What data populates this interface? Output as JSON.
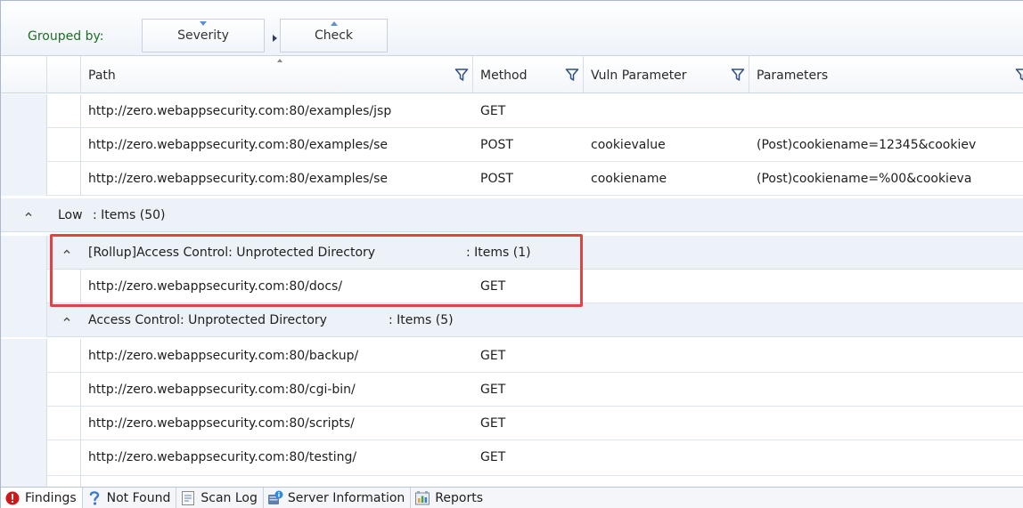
{
  "groupbar": {
    "label": "Grouped by:",
    "chips": [
      "Severity",
      "Check"
    ]
  },
  "columns": [
    "Path",
    "Method",
    "Vuln Parameter",
    "Parameters"
  ],
  "top_rows": [
    {
      "path": "http://zero.webappsecurity.com:80/examples/jsp",
      "method": "GET",
      "vuln_param": "",
      "params": ""
    },
    {
      "path": "http://zero.webappsecurity.com:80/examples/se",
      "method": "POST",
      "vuln_param": "cookievalue",
      "params": "(Post)cookiename=12345&cookiev"
    },
    {
      "path": "http://zero.webappsecurity.com:80/examples/se",
      "method": "POST",
      "vuln_param": "cookiename",
      "params": "(Post)cookiename=%00&cookieva"
    }
  ],
  "severity_group": {
    "name": "Low",
    "items": ": Items (50)"
  },
  "check_groups": [
    {
      "title": "[Rollup]Access Control: Unprotected Directory",
      "items": ": Items (1)",
      "rows": [
        {
          "path": "http://zero.webappsecurity.com:80/docs/",
          "method": "GET"
        }
      ]
    },
    {
      "title": "Access Control: Unprotected Directory",
      "items": ": Items (5)",
      "rows": [
        {
          "path": "http://zero.webappsecurity.com:80/backup/",
          "method": "GET"
        },
        {
          "path": "http://zero.webappsecurity.com:80/cgi-bin/",
          "method": "GET"
        },
        {
          "path": "http://zero.webappsecurity.com:80/scripts/",
          "method": "GET"
        },
        {
          "path": "http://zero.webappsecurity.com:80/testing/",
          "method": "GET"
        }
      ]
    }
  ],
  "tabs": [
    {
      "label": "Findings",
      "icon": "alert-icon",
      "active": true
    },
    {
      "label": "Not Found",
      "icon": "question-icon",
      "active": false
    },
    {
      "label": "Scan Log",
      "icon": "log-icon",
      "active": false
    },
    {
      "label": "Server Information",
      "icon": "server-info-icon",
      "active": false
    },
    {
      "label": "Reports",
      "icon": "reports-icon",
      "active": false
    }
  ],
  "colors": {
    "grouped_label": "#1f6f22",
    "highlight": "#e04343",
    "filter_icon": "#2f4f7f",
    "alert_icon": "#d01818"
  }
}
